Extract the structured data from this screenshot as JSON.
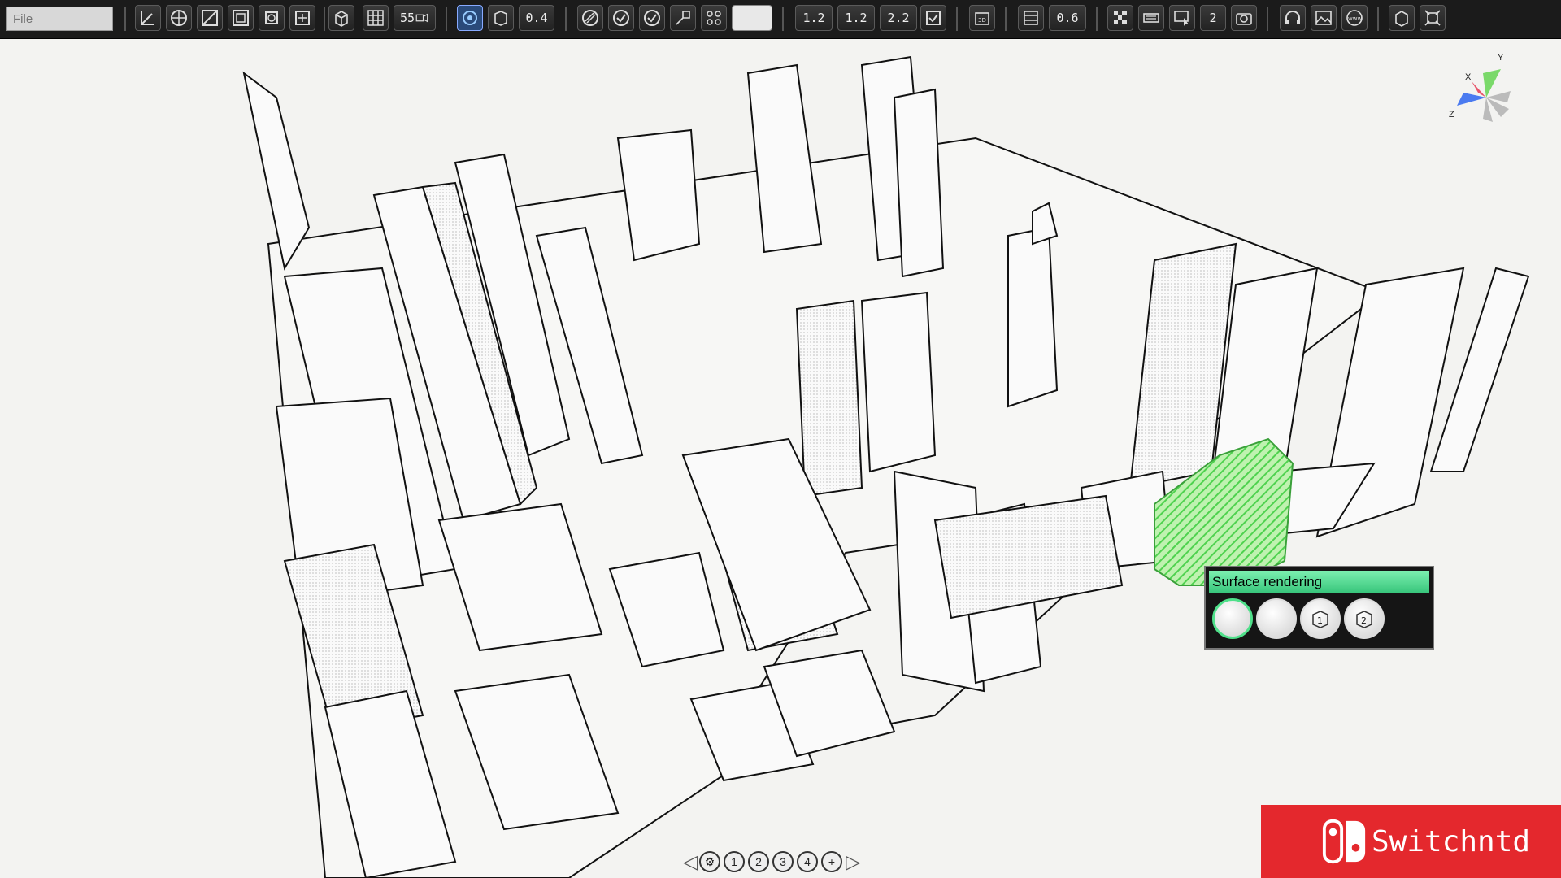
{
  "file": {
    "placeholder": "File"
  },
  "toolbar": {
    "values": {
      "cam_fov": "55",
      "line_width": "0.4",
      "val_a": "1.2",
      "val_b": "1.2",
      "val_c": "2.2",
      "val_d": "0.6",
      "page_num": "2"
    },
    "icons": [
      "axis-icon",
      "globe-icon",
      "slope-icon",
      "cube-frame-icon",
      "rotate-cube-icon",
      "move-cube-icon",
      "box-icon",
      "grid-icon",
      "camera-fov-icon",
      "target-icon",
      "face-icon",
      "stripe-icon",
      "check-circle-icon",
      "check-circle-icon",
      "extrude-icon",
      "dots-grid-icon",
      "box-3d-icon",
      "film-icon",
      "checkbox-icon",
      "checker-icon",
      "keyboard-icon",
      "cursor-frame-icon",
      "page-icon",
      "camera-icon",
      "headphones-icon",
      "image-icon",
      "www-icon",
      "number-cube-icon",
      "fit-icon"
    ]
  },
  "popup": {
    "title": "Surface rendering",
    "buttons": [
      {
        "name": "smooth-sphere",
        "selected": true
      },
      {
        "name": "flat-sphere",
        "selected": false
      },
      {
        "name": "cube-1",
        "label": "1"
      },
      {
        "name": "cube-2",
        "label": "2"
      }
    ]
  },
  "axis": {
    "x": "X",
    "y": "Y",
    "z": "Z",
    "colors": {
      "x": "#e8556a",
      "y": "#7ad96a",
      "z": "#4a7af0"
    }
  },
  "pager": {
    "items": [
      "1",
      "2",
      "3",
      "4"
    ]
  },
  "logo": {
    "text": "Switchntd",
    "color": "#e4282d"
  },
  "highlight_color": "#4fd24f"
}
